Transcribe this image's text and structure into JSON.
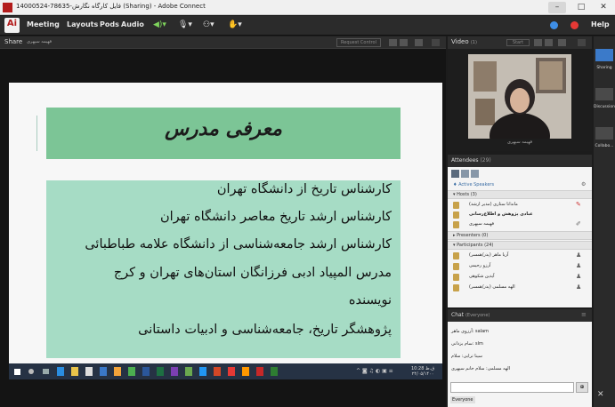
{
  "window": {
    "title": "14000524-78635-فایل کارگاه نگارش (Sharing) - Adobe Connect",
    "minimize": "–",
    "maximize": "□",
    "close": "✕"
  },
  "menubar": {
    "logo": "Ai",
    "items": [
      "Meeting",
      "Layouts",
      "Pods",
      "Audio"
    ],
    "help": "Help",
    "toolbar": {
      "speaker": "◀)▾",
      "mic": "🎙▾",
      "camera": "⚇▾",
      "hand": "✋▾"
    }
  },
  "share_pod": {
    "title": "Share",
    "presenter_label": "فهیمه سپهری",
    "request_control": "Request Control",
    "slide": {
      "title": "معرفی مدرس",
      "lines": [
        "کارشناس تاریخ از دانشگاه تهران",
        "کارشناس ارشد تاریخ معاصر دانشگاه تهران",
        "کارشناس ارشد جامعه‌شناسی از دانشگاه علامه طباطبائی",
        "مدرس المپیاد ادبی فرزانگان استان‌های تهران و کرج",
        "نویسنده",
        "پژوهشگر تاریخ، جامعه‌شناسی و ادبیات داستانی"
      ]
    },
    "taskbar": {
      "time": "10:28 ق.ظ",
      "date": "۲۴/۰۵/۱۴۰۰"
    }
  },
  "video_pod": {
    "title": "Video",
    "count": "(1)",
    "start_label": "Start",
    "participant_name": "فهیمه سپهری"
  },
  "attendees_pod": {
    "title": "Attendees",
    "count": "(29)",
    "active_speakers": "Active Speakers",
    "hosts_header": "Hosts (3)",
    "hosts": [
      "ماندانا ستاری (مدیر ارشد)",
      "عبادی پژوهش و اطلاع‌رسانی",
      "فهیمه سپهری"
    ],
    "presenters_header": "Presenters (0)",
    "participants_header": "Participants (24)",
    "participants": [
      "آریا ماهر (پدر/همسر)",
      "آرزو رحیمی",
      "آیدین شکوهی",
      "الهه مسلمی (پدر/همسر)"
    ]
  },
  "chat_pod": {
    "title": "Chat",
    "scope": "(Everyone)",
    "messages": [
      "آرزوی ماهر: salam",
      "سام یزدانی: slm",
      "سینا ترابی: سلام",
      "الهه مسلمی: سلام خانم سپهری"
    ],
    "send": "⊕",
    "recipient": "Everyone"
  },
  "right_rail": {
    "layouts": [
      "Sharing",
      "Discussion",
      "Collabo..."
    ]
  },
  "colors": {
    "slide_title_bg": "#7cc596",
    "slide_body_bg": "#a6dcc5",
    "window_bg": "#1c1c1c",
    "accent_blue": "#3b7ac9",
    "record_red": "#e53935"
  }
}
